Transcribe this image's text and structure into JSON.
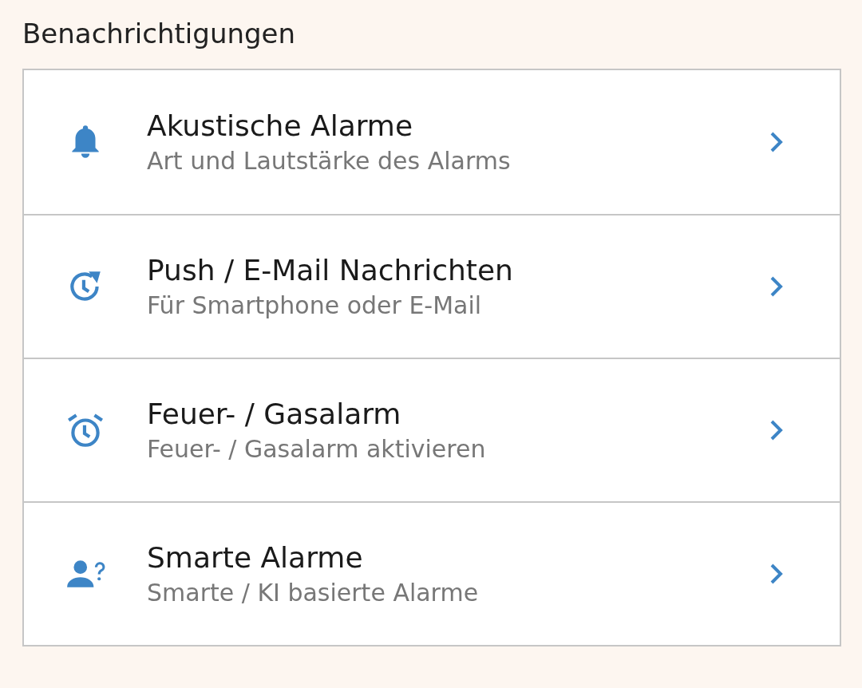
{
  "section_title": "Benachrichtigungen",
  "items": [
    {
      "title": "Akustische Alarme",
      "subtitle": "Art und Lautstärke des Alarms"
    },
    {
      "title": "Push / E-Mail Nachrichten",
      "subtitle": "Für Smartphone oder E-Mail"
    },
    {
      "title": "Feuer- / Gasalarm",
      "subtitle": "Feuer- / Gasalarm aktivieren"
    },
    {
      "title": "Smarte Alarme",
      "subtitle": "Smarte / KI basierte Alarme"
    }
  ]
}
